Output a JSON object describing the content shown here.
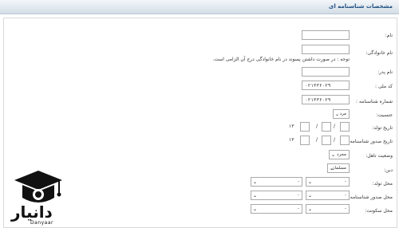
{
  "header": {
    "title": "مشخصات شناسنامه ای"
  },
  "labels": {
    "name": "نام:",
    "family": "نام خانوادگی:",
    "family_note": "توجه : در صورت داشتن پسوند در نام خانوادگی درج آن الزامی است.",
    "father": "نام پدر:",
    "national_code": "کد ملی :",
    "id_number": "شماره شناسنامه :",
    "gender": "جنسیت:",
    "birth_date": "تاریخ تولد:",
    "issue_date": "تاریخ صدور شناسنامه:",
    "marital": "وضعیت تاهل:",
    "religion": "دین:",
    "birth_place": "محل تولد:",
    "issue_place": "محل صدور شناسنامه:",
    "residence": "محل سکونت:"
  },
  "values": {
    "national_code": "۰۲۱۳۳۶۰۲۹",
    "id_number": "۰۲۱۳۳۶۰۲۹",
    "gender": "مرد",
    "marital": "مجرد",
    "religion": "مسلمان",
    "birth_year_prefix": "۱۳",
    "issue_year_prefix": "۱۳",
    "date_sep": "/"
  },
  "placeholder_option": "-",
  "logo": {
    "fa": "دانیار",
    "en": "Danyaar"
  }
}
